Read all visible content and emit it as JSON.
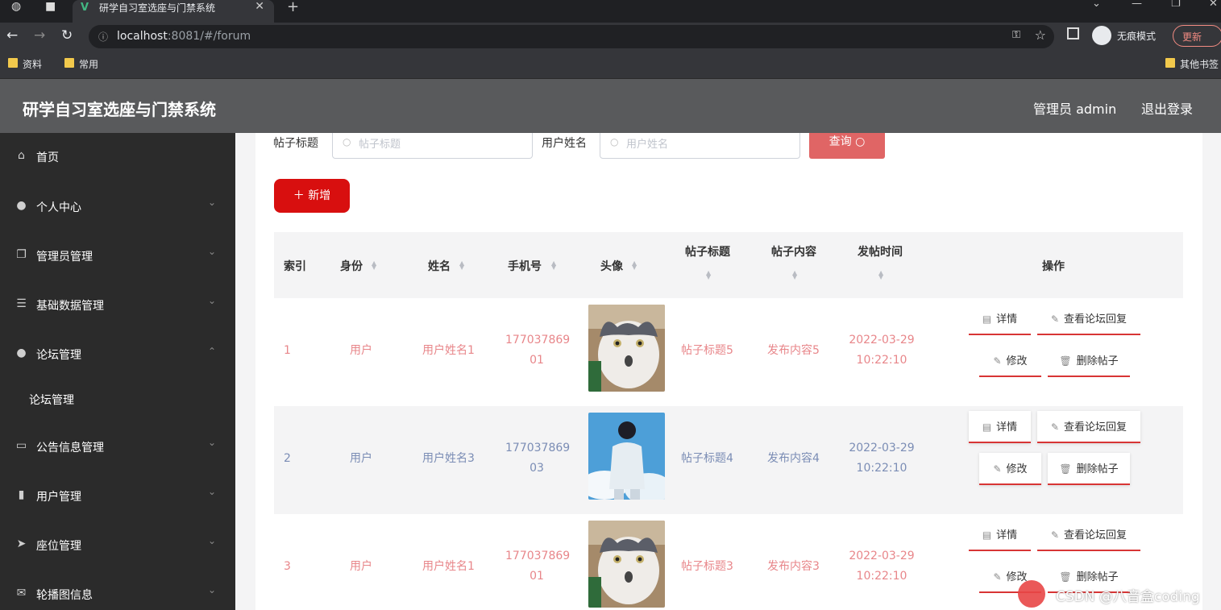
{
  "browser": {
    "tab_title": "研学自习室选座与门禁系统",
    "url_host": "localhost",
    "url_rest": ":8081/#/forum",
    "incognito_label": "无痕模式",
    "update_label": "更新",
    "bookmarks": [
      "资料",
      "常用",
      "其他书签"
    ]
  },
  "header": {
    "title": "研学自习室选座与门禁系统",
    "user": "管理员 admin",
    "logout": "退出登录"
  },
  "sidebar": {
    "items": [
      {
        "label": "首页",
        "icon": "home-icon",
        "expandable": false
      },
      {
        "label": "个人中心",
        "icon": "person-icon",
        "expandable": true
      },
      {
        "label": "管理员管理",
        "icon": "copy-icon",
        "expandable": true
      },
      {
        "label": "基础数据管理",
        "icon": "list-icon",
        "expandable": true
      },
      {
        "label": "论坛管理",
        "icon": "bulb-icon",
        "expandable": true,
        "open": true
      },
      {
        "label": "公告信息管理",
        "icon": "card-icon",
        "expandable": true
      },
      {
        "label": "用户管理",
        "icon": "bar-chart-icon",
        "expandable": true
      },
      {
        "label": "座位管理",
        "icon": "send-icon",
        "expandable": true
      },
      {
        "label": "轮播图信息",
        "icon": "mail-icon",
        "expandable": true
      }
    ],
    "sub_item": "论坛管理"
  },
  "search": {
    "title_label": "帖子标题",
    "title_placeholder": "帖子标题",
    "name_label": "用户姓名",
    "name_placeholder": "用户姓名",
    "query_label": "查询",
    "add_label": "新增"
  },
  "table": {
    "headers": {
      "index": "索引",
      "role": "身份",
      "name": "姓名",
      "phone": "手机号",
      "avatar": "头像",
      "post_title": "帖子标题",
      "content": "帖子内容",
      "time": "发帖时间",
      "actions": "操作"
    },
    "rows": [
      {
        "index": "1",
        "role": "用户",
        "name": "用户姓名1",
        "phone1": "177037869",
        "phone2": "01",
        "title": "帖子标题5",
        "content": "发布内容5",
        "date": "2022-03-29",
        "time": "10:22:10",
        "avatar": "cat",
        "color": "pink"
      },
      {
        "index": "2",
        "role": "用户",
        "name": "用户姓名3",
        "phone1": "177037869",
        "phone2": "03",
        "title": "帖子标题4",
        "content": "发布内容4",
        "date": "2022-03-29",
        "time": "10:22:10",
        "avatar": "boy",
        "color": "blue"
      },
      {
        "index": "3",
        "role": "用户",
        "name": "用户姓名1",
        "phone1": "177037869",
        "phone2": "01",
        "title": "帖子标题3",
        "content": "发布内容3",
        "date": "2022-03-29",
        "time": "10:22:10",
        "avatar": "cat",
        "color": "pink"
      }
    ],
    "actions": {
      "detail": "详情",
      "view_replies": "查看论坛回复",
      "edit": "修改",
      "delete": "删除帖子"
    }
  },
  "watermark": "CSDN @八音盒coding",
  "colors": {
    "accent": "#d80f0f",
    "header_bg": "#595a5c",
    "sidebar_bg": "#2b2b2b",
    "pink_text": "#e8868a",
    "blue_text": "#7b8db5"
  }
}
